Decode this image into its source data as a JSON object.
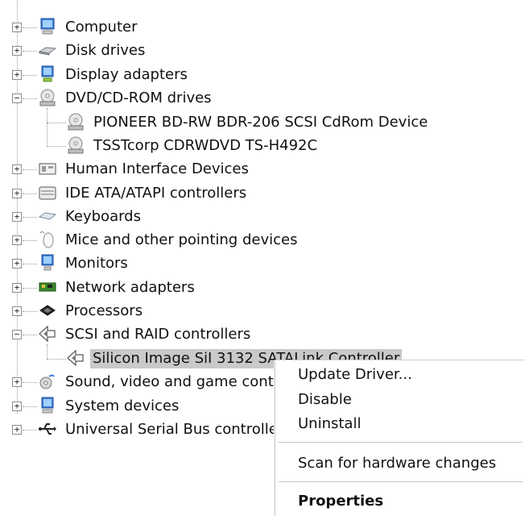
{
  "tree": {
    "items": [
      {
        "label": "Computer",
        "icon": "computer-icon",
        "expanded": false
      },
      {
        "label": "Disk drives",
        "icon": "disk-drive-icon",
        "expanded": false
      },
      {
        "label": "Display adapters",
        "icon": "monitor-icon",
        "expanded": false
      },
      {
        "label": "DVD/CD-ROM drives",
        "icon": "cd-drive-icon",
        "expanded": true
      },
      {
        "label": "PIONEER BD-RW   BDR-206 SCSI CdRom Device",
        "icon": "cd-drive-icon",
        "child": true
      },
      {
        "label": "TSSTcorp CDRWDVD TS-H492C",
        "icon": "cd-drive-icon",
        "child": true
      },
      {
        "label": "Human Interface Devices",
        "icon": "hid-icon",
        "expanded": false
      },
      {
        "label": "IDE ATA/ATAPI controllers",
        "icon": "ide-controller-icon",
        "expanded": false
      },
      {
        "label": "Keyboards",
        "icon": "keyboard-icon",
        "expanded": false
      },
      {
        "label": "Mice and other pointing devices",
        "icon": "mouse-icon",
        "expanded": false
      },
      {
        "label": "Monitors",
        "icon": "monitor-icon",
        "expanded": false
      },
      {
        "label": "Network adapters",
        "icon": "network-adapter-icon",
        "expanded": false
      },
      {
        "label": "Processors",
        "icon": "processor-icon",
        "expanded": false
      },
      {
        "label": "SCSI and RAID controllers",
        "icon": "scsi-icon",
        "expanded": true
      },
      {
        "label": "Silicon Image SiI 3132 SATALink Controller",
        "icon": "scsi-icon",
        "child": true,
        "selected": true
      },
      {
        "label": "Sound, video and game controllers",
        "icon": "sound-icon",
        "expanded": false
      },
      {
        "label": "System devices",
        "icon": "system-devices-icon",
        "expanded": false
      },
      {
        "label": "Universal Serial Bus controllers",
        "icon": "usb-icon",
        "expanded": false
      }
    ]
  },
  "context_menu": {
    "update_driver": "Update Driver...",
    "disable": "Disable",
    "uninstall": "Uninstall",
    "scan": "Scan for hardware changes",
    "properties": "Properties"
  },
  "glyphs": {
    "plus": "+",
    "minus": "−"
  },
  "colors": {
    "selection": "#c9c9c9",
    "connector": "#9a9a9a"
  }
}
